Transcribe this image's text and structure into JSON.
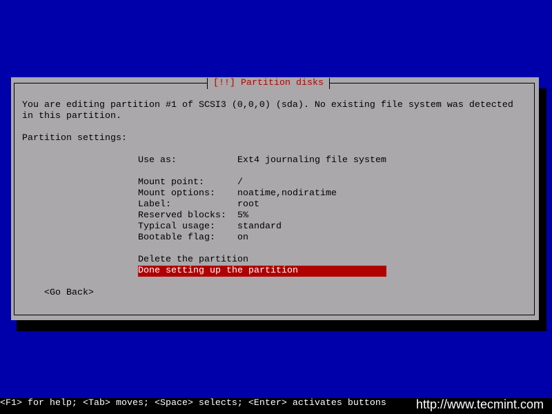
{
  "dialog": {
    "title": "[!!] Partition disks",
    "intro_line1": "You are editing partition #1 of SCSI3 (0,0,0) (sda). No existing file system was detected",
    "intro_line2": "in this partition.",
    "section": "Partition settings:",
    "settings": [
      {
        "label": "Use as:",
        "value": "Ext4 journaling file system"
      },
      {
        "label": "Mount point:",
        "value": "/"
      },
      {
        "label": "Mount options:",
        "value": "noatime,nodiratime"
      },
      {
        "label": "Label:",
        "value": "root"
      },
      {
        "label": "Reserved blocks:",
        "value": "5%"
      },
      {
        "label": "Typical usage:",
        "value": "standard"
      },
      {
        "label": "Bootable flag:",
        "value": "on"
      }
    ],
    "actions": [
      "Delete the partition",
      "Done setting up the partition"
    ],
    "go_back": "<Go Back>"
  },
  "status_bar": "<F1> for help; <Tab> moves; <Space> selects; <Enter> activates buttons",
  "watermark": "http://www.tecmint.com"
}
